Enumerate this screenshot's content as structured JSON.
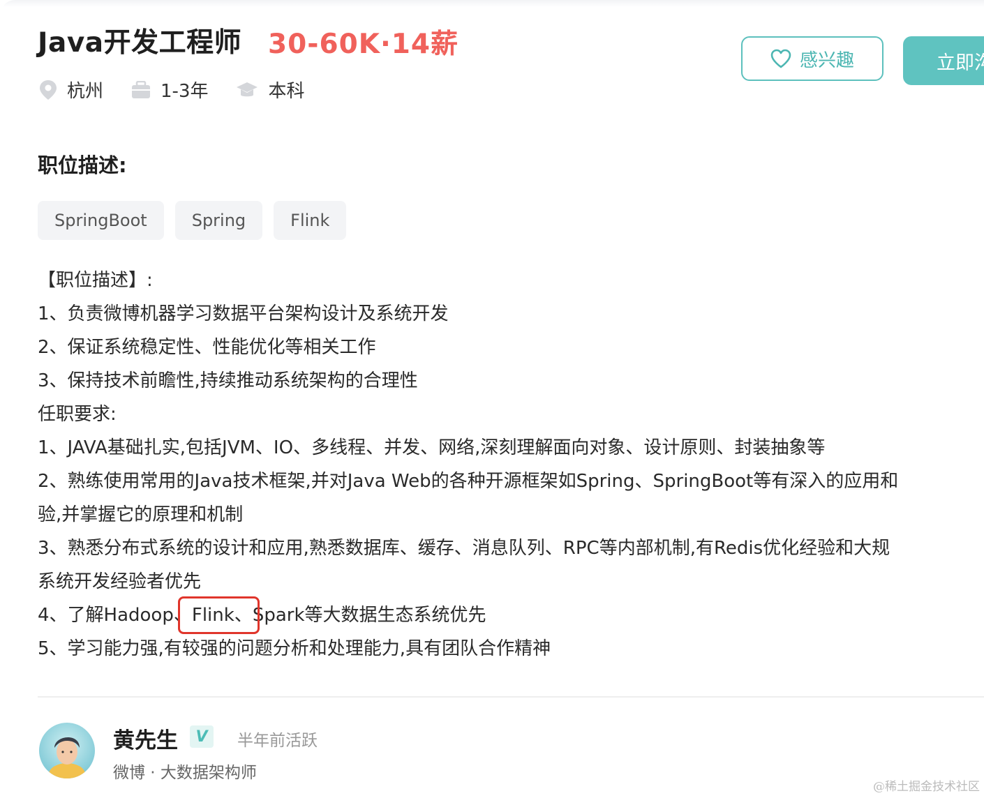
{
  "job": {
    "title": "Java开发工程师",
    "salary": "30-60K·14薪",
    "location": "杭州",
    "experience": "1-3年",
    "education": "本科"
  },
  "actions": {
    "interest_label": "感兴趣",
    "apply_label": "立即沟"
  },
  "description": {
    "section_title": "职位描述:",
    "tags": [
      "SpringBoot",
      "Spring",
      "Flink"
    ],
    "lines": [
      "【职位描述】:",
      "1、负责微博机器学习数据平台架构设计及系统开发",
      "2、保证系统稳定性、性能优化等相关工作",
      "3、保持技术前瞻性,持续推动系统架构的合理性",
      "任职要求:",
      "1、JAVA基础扎实,包括JVM、IO、多线程、并发、网络,深刻理解面向对象、设计原则、封装抽象等",
      "2、熟练使用常用的Java技术框架,并对Java Web的各种开源框架如Spring、SpringBoot等有深入的应用和",
      "验,并掌握它的原理和机制",
      "3、熟悉分布式系统的设计和应用,熟悉数据库、缓存、消息队列、RPC等内部机制,有Redis优化经验和大规",
      "系统开发经验者优先"
    ],
    "line4_prefix": "4、了解Hadoop、",
    "line4_highlight": "Flink、",
    "line4_suffix": "Spark等大数据生态系统优先",
    "line5": "5、学习能力强,有较强的问题分析和处理能力,具有团队合作精神"
  },
  "recruiter": {
    "name": "黄先生",
    "verified_badge": "V",
    "active_status": "半年前活跃",
    "role": "微博 · 大数据架构师"
  },
  "watermark": "@稀土掘金技术社区",
  "colors": {
    "salary": "#f0615b",
    "accent": "#5fc3c0",
    "highlight_box": "#e0352b"
  },
  "icons": {
    "location": "location-pin-icon",
    "experience": "briefcase-icon",
    "education": "graduation-cap-icon",
    "interest": "heart-icon"
  }
}
